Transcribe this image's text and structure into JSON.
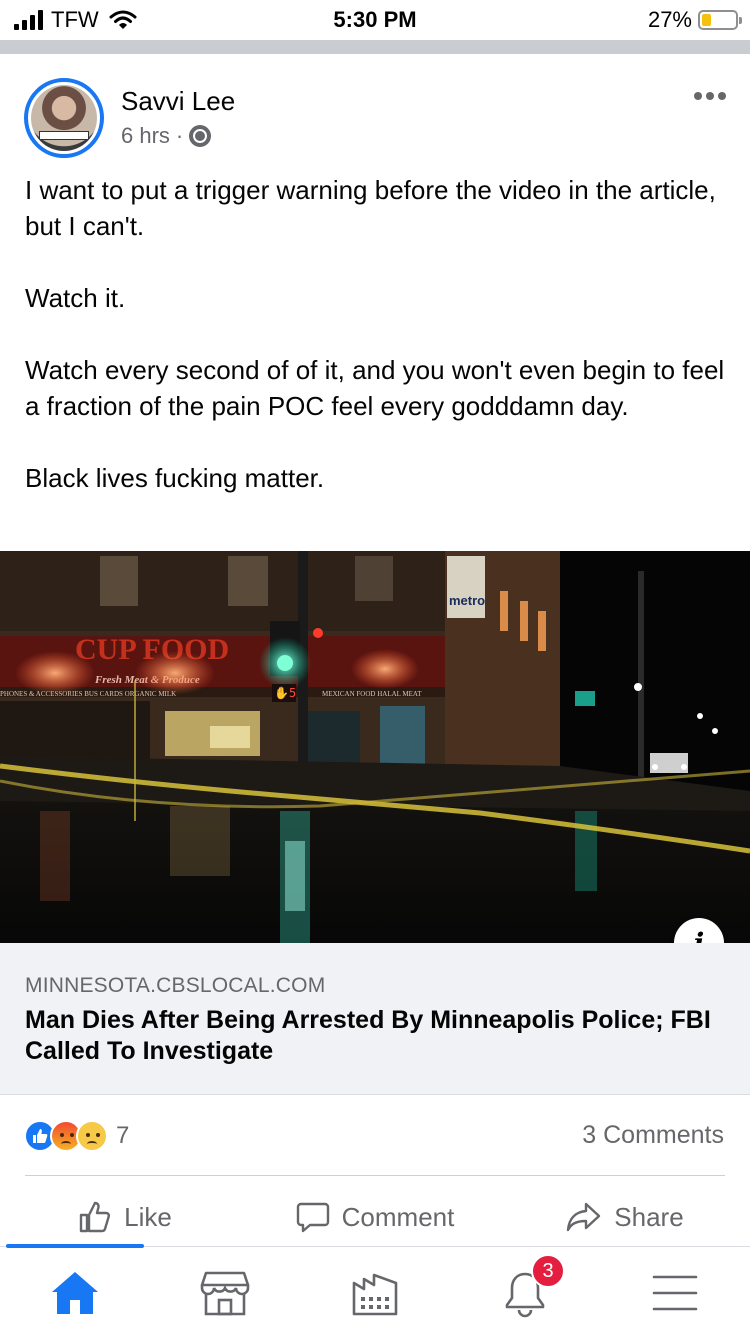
{
  "status_bar": {
    "carrier": "TFW",
    "time": "5:30 PM",
    "battery_percent": "27%",
    "battery_level": 0.27,
    "icons": [
      "signal-bars-icon",
      "wifi-icon",
      "battery-icon"
    ]
  },
  "post": {
    "author": "Savvi Lee",
    "time_ago": "6 hrs",
    "separator": "·",
    "privacy_icon": "globe-icon",
    "avatar_caption": "Wash Your Hands",
    "paragraphs": [
      "I want to put a trigger warning before the video in the article, but I can't.",
      "Watch it.",
      "Watch every second of of it, and you won't even begin to feel a fraction of the pain POC feel every godddamn day.",
      "Black lives fucking matter."
    ],
    "link": {
      "image_signs": {
        "store_name": "CUP FOOD",
        "subtitle": "Fresh Meat & Produce",
        "left_sign": "PHONES & ACCESSORIES  BUS CARDS  ORGANIC MILK",
        "right_sign": "MEXICAN FOOD  HALAL MEAT",
        "top_sign": "metro"
      },
      "info_label": "i",
      "domain": "MINNESOTA.CBSLOCAL.COM",
      "title": "Man Dies After Being Arrested By Minneapolis Police; FBI Called To Investigate"
    },
    "reactions": {
      "types": [
        "like",
        "angry",
        "sad"
      ],
      "count": "7"
    },
    "comments_label": "3 Comments",
    "actions": {
      "like": "Like",
      "comment": "Comment",
      "share": "Share"
    }
  },
  "tab_bar": {
    "tabs": [
      "home-icon",
      "marketplace-icon",
      "pages-icon",
      "notifications-icon",
      "menu-icon"
    ],
    "notifications_badge": "3",
    "active_color": "#1877f2",
    "inactive_color": "#65676b"
  },
  "colors": {
    "brand": "#1877f2",
    "secondary_text": "#65676b",
    "badge": "#e41e3f"
  }
}
